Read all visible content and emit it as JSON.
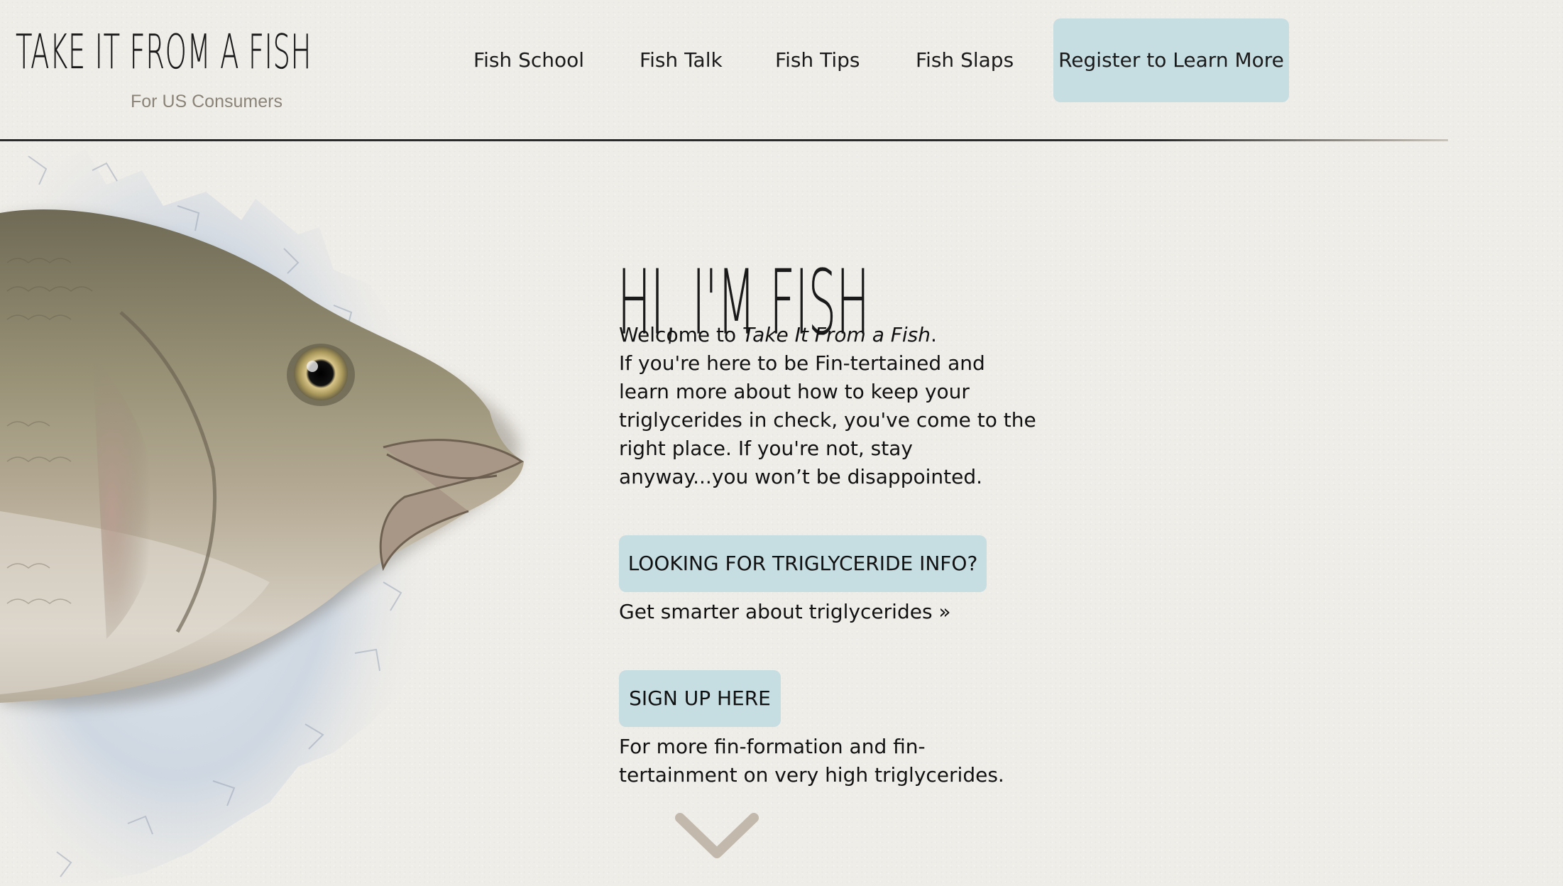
{
  "header": {
    "logo_title": "TAKE IT FROM A FISH",
    "logo_subtitle": "For US Consumers",
    "nav": [
      {
        "label": "Fish School"
      },
      {
        "label": "Fish Talk"
      },
      {
        "label": "Fish Tips"
      },
      {
        "label": "Fish Slaps"
      }
    ],
    "register_label": "Register to Learn More"
  },
  "hero": {
    "headline": "HI, I'M FISH",
    "intro": {
      "welcome_prefix": "Welcome to ",
      "welcome_site_name": "Take It From a Fish",
      "welcome_suffix": ".",
      "lines": [
        "If you're here to be Fin-tertained and",
        "learn more about how to keep your",
        "triglycerides in check, you've come to the",
        "right place. If you're not, stay",
        "anyway...you won’t be disappointed."
      ]
    },
    "cta_info": {
      "button_label": "LOOKING FOR TRIGLYCERIDE INFO?",
      "link_text": "Get smarter about triglycerides »"
    },
    "cta_signup": {
      "button_label": "SIGN UP HERE",
      "text_lines": [
        "For more fin-formation and fin-",
        "tertainment on very high triglycerides."
      ]
    }
  },
  "colors": {
    "background": "#efede8",
    "button_bg": "#c6dde2",
    "text": "#111111",
    "subtitle": "#8a8378",
    "chevron": "#c2b8ab"
  },
  "icons": {
    "scroll_down": "chevron-down-icon"
  }
}
